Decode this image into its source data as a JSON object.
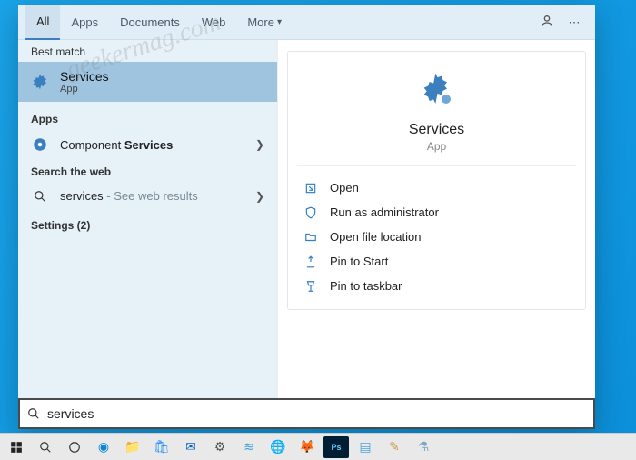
{
  "tabs": {
    "all": "All",
    "apps": "Apps",
    "documents": "Documents",
    "web": "Web",
    "more": "More"
  },
  "left": {
    "best_match": "Best match",
    "services": {
      "title": "Services",
      "sub": "App"
    },
    "apps_label": "Apps",
    "component": {
      "prefix": "Component ",
      "bold": "Services"
    },
    "search_web_label": "Search the web",
    "webrow": {
      "q": "services",
      "suffix": " - See web results"
    },
    "settings": "Settings (2)"
  },
  "right": {
    "title": "Services",
    "sub": "App",
    "actions": {
      "open": "Open",
      "admin": "Run as administrator",
      "loc": "Open file location",
      "pin_start": "Pin to Start",
      "pin_task": "Pin to taskbar"
    }
  },
  "search": {
    "value": "services"
  },
  "watermark": "geekermag.com"
}
